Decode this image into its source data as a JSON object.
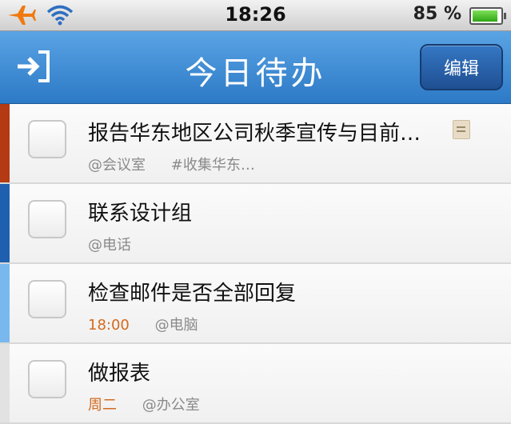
{
  "status": {
    "time": "18:26",
    "battery": "85 %"
  },
  "navbar": {
    "title": "今日待办",
    "edit_label": "编辑"
  },
  "tasks": [
    {
      "title": "报告华东地区公司秋季宣传与目前…",
      "context": "@会议室",
      "tag": "#收集华东…",
      "due": "",
      "color": "#b33a12",
      "has_note": true
    },
    {
      "title": "联系设计组",
      "context": "@电话",
      "tag": "",
      "due": "",
      "color": "#1f5fb0",
      "has_note": false
    },
    {
      "title": "检查邮件是否全部回复",
      "context": "@电脑",
      "tag": "",
      "due": "18:00",
      "color": "#79b8ee",
      "has_note": false
    },
    {
      "title": "做报表",
      "context": "@办公室",
      "tag": "",
      "due": "周二",
      "color": "#e2e2e2",
      "has_note": false
    }
  ],
  "colors": {
    "nav_top": "#5aa4e4",
    "nav_bottom": "#2c79c6",
    "due_text": "#d46a1f"
  }
}
